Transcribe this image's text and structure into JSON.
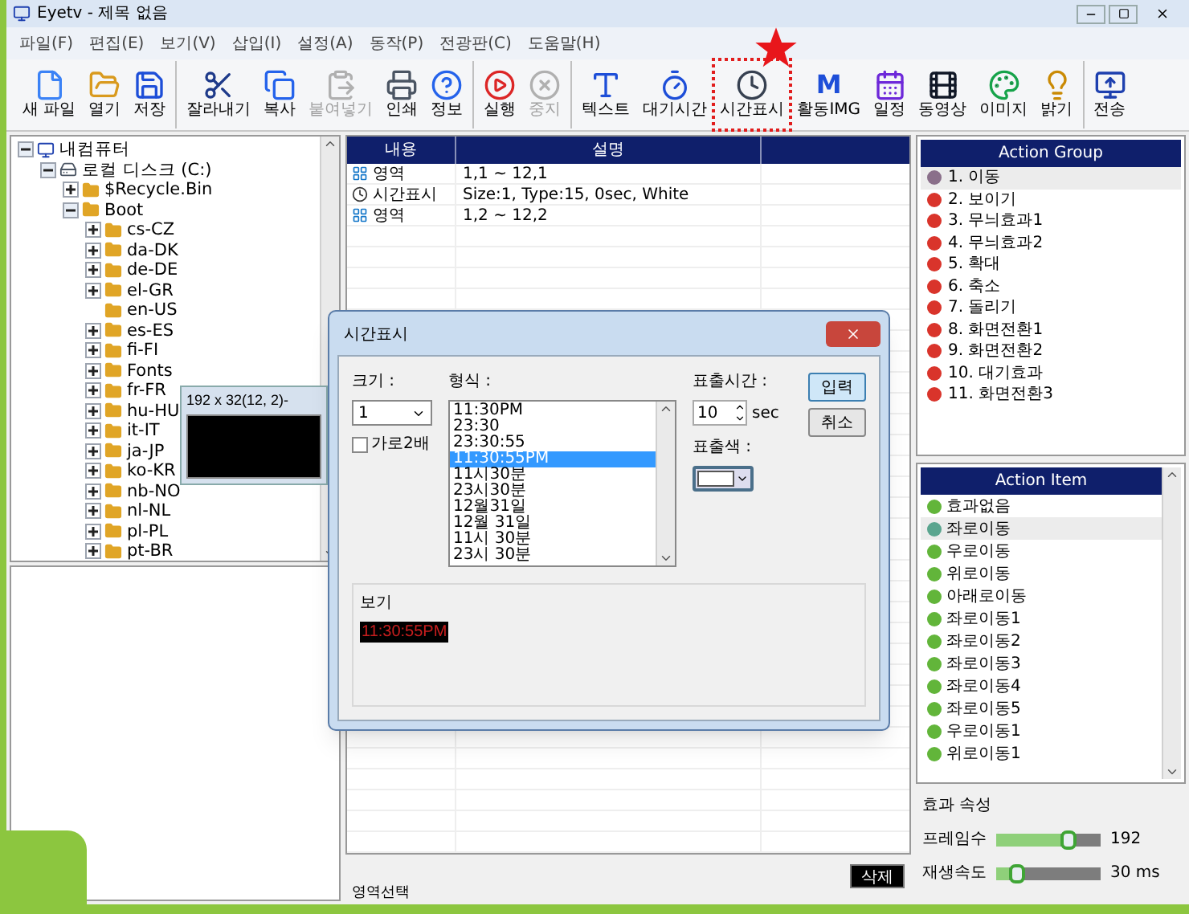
{
  "window": {
    "title": "Eyetv - 제목 없음"
  },
  "menu": [
    "파일(F)",
    "편집(E)",
    "보기(V)",
    "삽입(I)",
    "설정(A)",
    "동작(P)",
    "전광판(C)",
    "도움말(H)"
  ],
  "toolbar": [
    [
      {
        "kind": "new",
        "label": "새 파일",
        "disabled": false,
        "highlighted": false
      },
      {
        "kind": "open",
        "label": "열기",
        "disabled": false,
        "highlighted": false
      },
      {
        "kind": "save",
        "label": "저장",
        "disabled": false,
        "highlighted": false
      }
    ],
    [
      {
        "kind": "cut",
        "label": "잘라내기",
        "disabled": false,
        "highlighted": false
      },
      {
        "kind": "copy",
        "label": "복사",
        "disabled": false,
        "highlighted": false
      },
      {
        "kind": "paste",
        "label": "붙여넣기",
        "disabled": true,
        "highlighted": false
      },
      {
        "kind": "print",
        "label": "인쇄",
        "disabled": false,
        "highlighted": false
      },
      {
        "kind": "info",
        "label": "정보",
        "disabled": false,
        "highlighted": false
      }
    ],
    [
      {
        "kind": "run",
        "label": "실행",
        "disabled": false,
        "highlighted": false
      },
      {
        "kind": "stop",
        "label": "중지",
        "disabled": true,
        "highlighted": false
      }
    ],
    [
      {
        "kind": "text",
        "label": "텍스트",
        "disabled": false,
        "highlighted": false
      },
      {
        "kind": "wait",
        "label": "대기시간",
        "disabled": false,
        "highlighted": false
      },
      {
        "kind": "clock",
        "label": "시간표시",
        "disabled": false,
        "highlighted": true
      },
      {
        "kind": "glyph",
        "glyph": "M",
        "label": "활동IMG",
        "disabled": false,
        "highlighted": false
      },
      {
        "kind": "schedule",
        "label": "일정",
        "disabled": false,
        "highlighted": false
      },
      {
        "kind": "video",
        "label": "동영상",
        "disabled": false,
        "highlighted": false
      },
      {
        "kind": "image",
        "label": "이미지",
        "disabled": false,
        "highlighted": false
      },
      {
        "kind": "bright",
        "label": "밝기",
        "disabled": false,
        "highlighted": false
      }
    ],
    [
      {
        "kind": "send",
        "label": "전송",
        "disabled": false,
        "highlighted": false
      }
    ]
  ],
  "tree": [
    {
      "kind": "computer",
      "label": "내컴퓨터",
      "expanded": true,
      "children": [
        {
          "kind": "drive",
          "label": "로컬 디스크 (C:)",
          "expanded": true,
          "children": [
            {
              "kind": "folder",
              "label": "$Recycle.Bin",
              "expanded": false
            },
            {
              "kind": "folder",
              "label": "Boot",
              "expanded": true,
              "children": [
                {
                  "kind": "folder",
                  "label": "cs-CZ",
                  "expanded": false
                },
                {
                  "kind": "folder",
                  "label": "da-DK",
                  "expanded": false
                },
                {
                  "kind": "folder",
                  "label": "de-DE",
                  "expanded": false
                },
                {
                  "kind": "folder",
                  "label": "el-GR",
                  "expanded": false
                },
                {
                  "kind": "empty_folder",
                  "label": "en-US"
                },
                {
                  "kind": "folder",
                  "label": "es-ES",
                  "expanded": false
                },
                {
                  "kind": "folder",
                  "label": "fi-FI",
                  "expanded": false
                },
                {
                  "kind": "folder",
                  "label": "Fonts",
                  "expanded": false
                },
                {
                  "kind": "folder",
                  "label": "fr-FR",
                  "expanded": false
                },
                {
                  "kind": "folder",
                  "label": "hu-HU",
                  "expanded": false
                },
                {
                  "kind": "folder",
                  "label": "it-IT",
                  "expanded": false
                },
                {
                  "kind": "folder",
                  "label": "ja-JP",
                  "expanded": false
                },
                {
                  "kind": "folder",
                  "label": "ko-KR",
                  "expanded": false
                },
                {
                  "kind": "folder",
                  "label": "nb-NO",
                  "expanded": false
                },
                {
                  "kind": "folder",
                  "label": "nl-NL",
                  "expanded": false
                },
                {
                  "kind": "folder",
                  "label": "pl-PL",
                  "expanded": false
                },
                {
                  "kind": "folder",
                  "label": "pt-BR",
                  "expanded": false
                }
              ]
            }
          ]
        }
      ]
    }
  ],
  "overlay_window": {
    "title": "192 x 32(12, 2)-"
  },
  "table": {
    "columns": [
      "내용",
      "설명"
    ],
    "rows": [
      {
        "kind": "area",
        "content": "영역",
        "description": "1,1 ~ 12,1"
      },
      {
        "kind": "time",
        "content": "시간표시",
        "description": "Size:1, Type:15, 0sec, White"
      },
      {
        "kind": "area",
        "content": "영역",
        "description": "1,2 ~ 12,2"
      }
    ]
  },
  "delete_button": "삭제",
  "bottom_label": "영역선택",
  "action_group": {
    "title": "Action Group",
    "items": [
      {
        "label": "1. 이동",
        "selected": true
      },
      {
        "label": "2. 보이기",
        "selected": false
      },
      {
        "label": "3. 무늬효과1",
        "selected": false
      },
      {
        "label": "4. 무늬효과2",
        "selected": false
      },
      {
        "label": "5. 확대",
        "selected": false
      },
      {
        "label": "6. 축소",
        "selected": false
      },
      {
        "label": "7. 돌리기",
        "selected": false
      },
      {
        "label": "8. 화면전환1",
        "selected": false
      },
      {
        "label": "9. 화면전환2",
        "selected": false
      },
      {
        "label": "10. 대기효과",
        "selected": false
      },
      {
        "label": "11. 화면전환3",
        "selected": false
      }
    ]
  },
  "action_item": {
    "title": "Action Item",
    "items": [
      {
        "label": "효과없음",
        "selected": false
      },
      {
        "label": "좌로이동",
        "selected": true
      },
      {
        "label": "우로이동",
        "selected": false
      },
      {
        "label": "위로이동",
        "selected": false
      },
      {
        "label": "아래로이동",
        "selected": false
      },
      {
        "label": "좌로이동1",
        "selected": false
      },
      {
        "label": "좌로이동2",
        "selected": false
      },
      {
        "label": "좌로이동3",
        "selected": false
      },
      {
        "label": "좌로이동4",
        "selected": false
      },
      {
        "label": "좌로이동5",
        "selected": false
      },
      {
        "label": "우로이동1",
        "selected": false
      },
      {
        "label": "위로이동1",
        "selected": false
      }
    ]
  },
  "effect_properties": {
    "title": "효과 속성",
    "sliders": [
      {
        "label": "프레임수",
        "level": 0.62,
        "reading": "192"
      },
      {
        "label": "재생속도",
        "level": 0.12,
        "reading": "30 ms"
      }
    ]
  },
  "dialog": {
    "title": "시간표시",
    "size_label": "크기 :",
    "size_value": "1",
    "double_width": {
      "label": "가로2배",
      "checked": false
    },
    "format_label": "형식 :",
    "formats": [
      {
        "label": "11:30PM",
        "selected": false
      },
      {
        "label": "23:30",
        "selected": false
      },
      {
        "label": "23:30:55",
        "selected": false
      },
      {
        "label": "11:30:55PM",
        "selected": true
      },
      {
        "label": "11시30분",
        "selected": false
      },
      {
        "label": "23시30분",
        "selected": false
      },
      {
        "label": "12월31일",
        "selected": false
      },
      {
        "label": "12월 31일",
        "selected": false
      },
      {
        "label": "11시 30분",
        "selected": false
      },
      {
        "label": "23시 30분",
        "selected": false
      }
    ],
    "duration_label": "표출시간 :",
    "duration_value": "10",
    "duration_unit": "sec",
    "color_label": "표출색 :",
    "color": "#ffffff",
    "buttons": [
      {
        "label": "입력",
        "default": true
      },
      {
        "label": "취소",
        "default": false
      }
    ],
    "preview_label": "보기",
    "preview_text": "11:30:55PM"
  }
}
